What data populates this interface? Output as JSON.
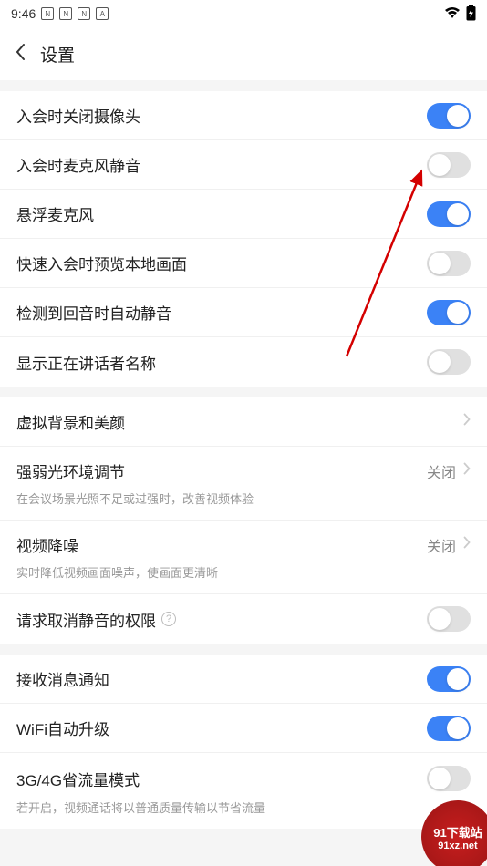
{
  "statusBar": {
    "time": "9:46",
    "icons": [
      "N",
      "N",
      "N",
      "A"
    ]
  },
  "header": {
    "title": "设置"
  },
  "sections": [
    {
      "rows": [
        {
          "label": "入会时关闭摄像头",
          "toggle": true
        },
        {
          "label": "入会时麦克风静音",
          "toggle": false
        },
        {
          "label": "悬浮麦克风",
          "toggle": true
        },
        {
          "label": "快速入会时预览本地画面",
          "toggle": false
        },
        {
          "label": "检测到回音时自动静音",
          "toggle": true
        },
        {
          "label": "显示正在讲话者名称",
          "toggle": false
        }
      ]
    },
    {
      "rows": [
        {
          "label": "虚拟背景和美颜",
          "nav": true
        },
        {
          "label": "强弱光环境调节",
          "value": "关闭",
          "nav": true,
          "sub": "在会议场景光照不足或过强时，改善视频体验"
        },
        {
          "label": "视频降噪",
          "value": "关闭",
          "nav": true,
          "sub": "实时降低视频画面噪声，使画面更清晰"
        },
        {
          "label": "请求取消静音的权限",
          "help": true,
          "toggle": false
        }
      ]
    },
    {
      "rows": [
        {
          "label": "接收消息通知",
          "toggle": true
        },
        {
          "label": "WiFi自动升级",
          "toggle": true
        },
        {
          "label": "3G/4G省流量模式",
          "toggle": false,
          "sub": "若开启，视频通话将以普通质量传输以节省流量"
        }
      ]
    }
  ],
  "watermark": {
    "top": "91下载站",
    "bottom": "91xz.net"
  }
}
